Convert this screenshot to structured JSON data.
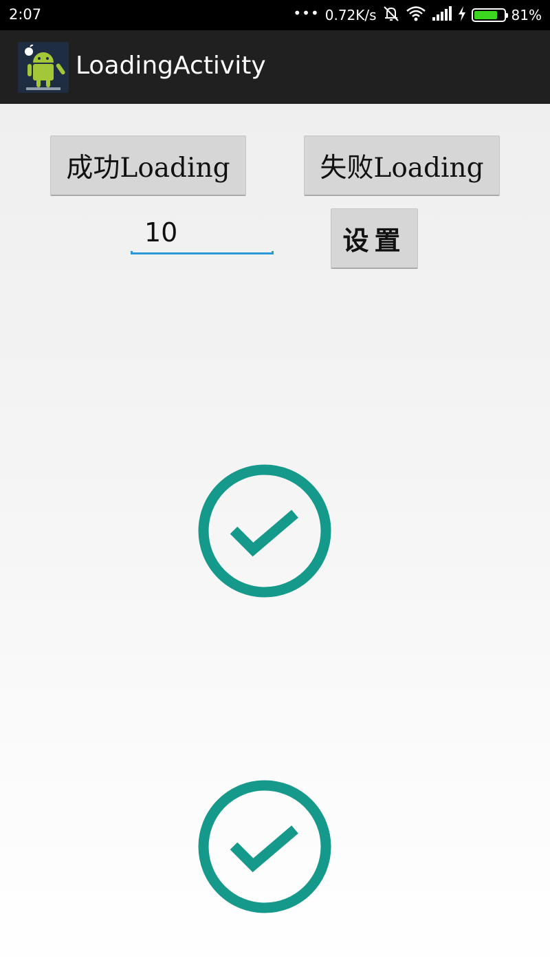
{
  "status_bar": {
    "time": "2:07",
    "dots": "•••",
    "net_speed": "0.72K/s",
    "battery_level": 0.81,
    "battery_text": "81%",
    "battery_color": "#3cd51f",
    "icons": [
      "mute-icon",
      "wifi-icon",
      "signal-icon",
      "charging-bolt-icon",
      "battery-icon"
    ]
  },
  "action_bar": {
    "title": "LoadingActivity",
    "icon": "android-app-icon"
  },
  "main": {
    "success_button": "成功Loading",
    "fail_button": "失败Loading",
    "count_value": "10",
    "set_button": "设置"
  },
  "indicators": {
    "icon": "check-circle-icon",
    "color": "#14998a"
  },
  "colors": {
    "accent": "#2a9ad6",
    "success": "#14998a",
    "button_bg": "#d6d6d6",
    "action_bar": "#202020"
  }
}
